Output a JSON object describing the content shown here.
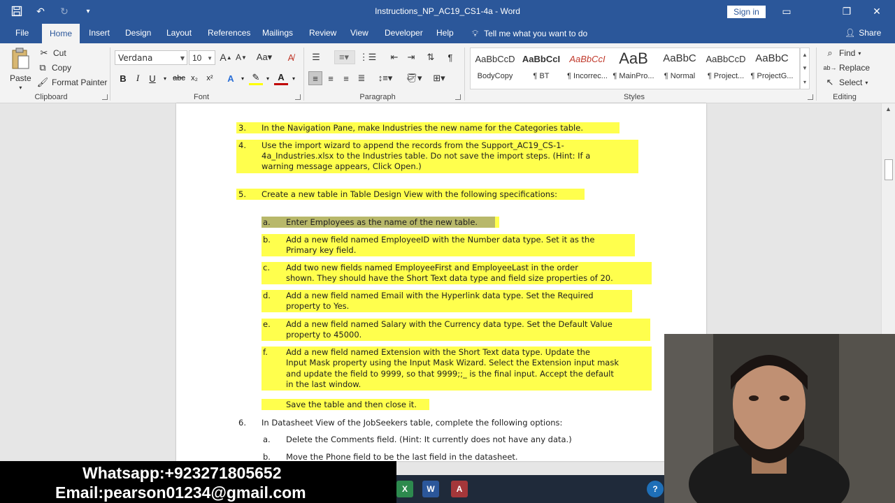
{
  "window": {
    "title": "Instructions_NP_AC19_CS1-4a  -  Word",
    "sign_in": "Sign in"
  },
  "menu": {
    "tabs": [
      {
        "label": "File"
      },
      {
        "label": "Home"
      },
      {
        "label": "Insert"
      },
      {
        "label": "Design"
      },
      {
        "label": "Layout"
      },
      {
        "label": "References"
      },
      {
        "label": "Mailings"
      },
      {
        "label": "Review"
      },
      {
        "label": "View"
      },
      {
        "label": "Developer"
      },
      {
        "label": "Help"
      }
    ],
    "active_tab": "Home",
    "tell_me": "Tell me what you want to do",
    "share": "Share"
  },
  "ribbon": {
    "clipboard": {
      "label": "Clipboard",
      "paste": "Paste",
      "cut": "Cut",
      "copy": "Copy",
      "format_painter": "Format Painter"
    },
    "font": {
      "label": "Font",
      "family": "Verdana",
      "size": "10"
    },
    "paragraph": {
      "label": "Paragraph"
    },
    "styles": {
      "label": "Styles",
      "items": [
        {
          "sample": "AaBbCcD",
          "name": "BodyCopy"
        },
        {
          "sample": "AaBbCcI",
          "name": "¶ BT"
        },
        {
          "sample": "AaBbCcI",
          "name": "¶ Incorrec..."
        },
        {
          "sample": "AaB",
          "name": "¶ MainPro..."
        },
        {
          "sample": "AaBbC",
          "name": "¶ Normal"
        },
        {
          "sample": "AaBbCcD",
          "name": "¶ Project..."
        },
        {
          "sample": "AaBbC",
          "name": "¶ ProjectG..."
        }
      ]
    },
    "editing": {
      "label": "Editing",
      "find": "Find",
      "replace": "Replace",
      "select": "Select"
    }
  },
  "document": {
    "items": [
      {
        "num": "3.",
        "lines": [
          "In the Navigation Pane, make Industries the new name for the Categories table."
        ]
      },
      {
        "num": "4.",
        "lines": [
          "Use the import wizard to append the records from the Support_AC19_CS-1-",
          "4a_Industries.xlsx to the Industries table. Do not save the import steps. (Hint: If a",
          "warning message appears, Click Open.)"
        ]
      },
      {
        "num": "5.",
        "lines": [
          "Create a new table in Table Design View with the following specifications:"
        ]
      },
      {
        "num": "a.",
        "lines": [
          "Enter Employees as the name of the new table."
        ]
      },
      {
        "num": "b.",
        "lines": [
          "Add a new field named EmployeeID with the Number data type. Set it as the",
          "Primary key field."
        ]
      },
      {
        "num": "c.",
        "lines": [
          "Add two new fields named EmployeeFirst and EmployeeLast in the order",
          "shown. They should have the Short Text data type and field size properties of 20."
        ]
      },
      {
        "num": "d.",
        "lines": [
          "Add a new field named Email with the Hyperlink data type. Set the Required",
          "property to Yes."
        ]
      },
      {
        "num": "e.",
        "lines": [
          "Add a new field named Salary with the Currency data type. Set the Default Value",
          "property to 45000."
        ]
      },
      {
        "num": "f.",
        "lines": [
          "Add a new field named Extension with the Short Text data type. Update the",
          "Input Mask property using the Input Mask Wizard. Select the Extension input mask",
          "and update the field to 9999, so that 9999;;_ is the final input. Accept the default",
          "in the last window."
        ]
      },
      {
        "num": "",
        "lines": [
          "Save the table and then close it."
        ]
      },
      {
        "num": "6.",
        "lines": [
          "In Datasheet View of the JobSeekers table, complete the following options:"
        ]
      },
      {
        "num": "a.",
        "lines": [
          "Delete the Comments field. (Hint: It currently does not have any data.)"
        ]
      },
      {
        "num": "b.",
        "lines": [
          "Move the Phone field to be the last field in the datasheet."
        ]
      }
    ]
  },
  "overlay": {
    "whatsapp": "Whatsapp:+923271805652",
    "email": "Email:pearson01234@gmail.com"
  },
  "colors": {
    "word_blue": "#2b579a",
    "highlight": "#ffff4d"
  }
}
